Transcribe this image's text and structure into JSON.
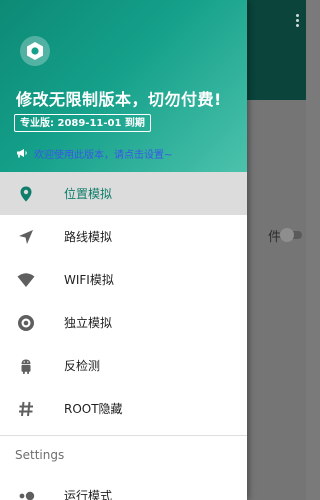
{
  "background_app": {
    "truncated_label": "件"
  },
  "drawer": {
    "header": {
      "title": "修改无限制版本，切勿付费!",
      "expiry_badge": "专业版: 2089-11-01 到期",
      "notice": "欢迎使用此版本，请点击设置~",
      "accent": "#14a08a"
    },
    "menu": [
      {
        "label": "位置模拟",
        "icon": "location-pin-icon",
        "active": true
      },
      {
        "label": "路线模拟",
        "icon": "navigation-arrow-icon",
        "active": false
      },
      {
        "label": "WIFI模拟",
        "icon": "wifi-icon",
        "active": false
      },
      {
        "label": "独立模拟",
        "icon": "target-circle-icon",
        "active": false
      },
      {
        "label": "反检测",
        "icon": "android-icon",
        "active": false
      },
      {
        "label": "ROOT隐藏",
        "icon": "hash-icon",
        "active": false
      }
    ],
    "settings_section": {
      "header": "Settings",
      "items": [
        {
          "label": "运行模式",
          "icon": "toggle-dots-icon"
        }
      ]
    }
  }
}
